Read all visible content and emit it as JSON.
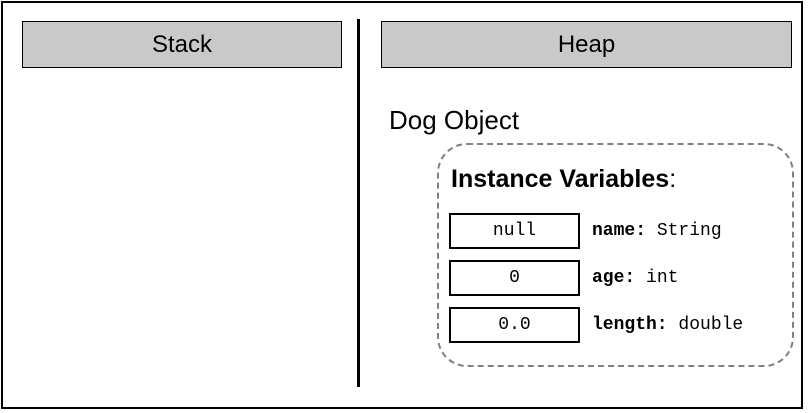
{
  "stack": {
    "title": "Stack"
  },
  "heap": {
    "title": "Heap",
    "object": {
      "title": "Dog Object",
      "instance_heading": "Instance Variables",
      "instance_heading_suffix": ":",
      "variables": [
        {
          "value": "null",
          "name": "name:",
          "type": " String"
        },
        {
          "value": "0",
          "name": "age:",
          "type": " int"
        },
        {
          "value": "0.0",
          "name": "length:",
          "type": " double"
        }
      ]
    }
  }
}
